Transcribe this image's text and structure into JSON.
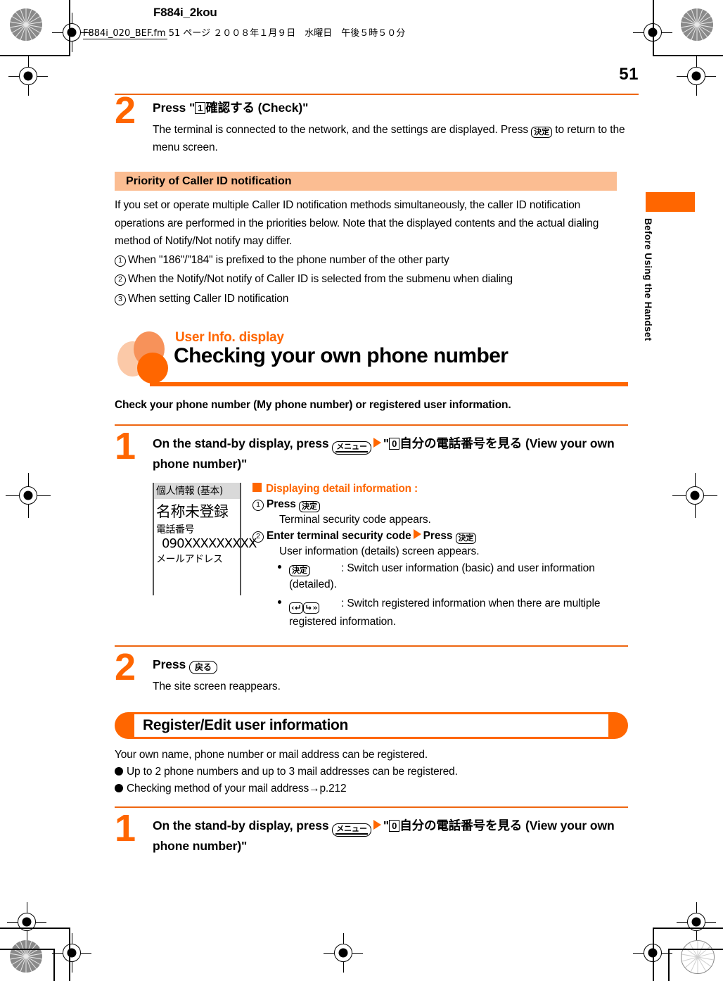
{
  "header": {
    "job_name": "F884i_2kou",
    "fm_line": "F884i_020_BEF.fm  51 ページ  ２００８年１月９日　水曜日　午後５時５０分",
    "page_number": "51"
  },
  "side_tab": {
    "label": "Before Using the Handset"
  },
  "step_top": {
    "number": "2",
    "title_pre": "Press \"",
    "title_key": "1",
    "title_jp": "確認する",
    "title_post": " (Check)\"",
    "body_pre": "The terminal is connected to the network, and the settings are displayed. Press ",
    "body_key": "決定",
    "body_post": " to return to the menu screen."
  },
  "priority_section": {
    "heading": "Priority of Caller ID notification",
    "paragraph": "If you set or operate multiple Caller ID notification methods simultaneously, the caller ID notification operations are performed in the priorities below. Note that the displayed contents and the actual dialing method of Notify/Not notify may differ.",
    "items": [
      {
        "marker": "1",
        "text": "When \"186\"/\"184\" is prefixed to the phone number of the other party"
      },
      {
        "marker": "2",
        "text": "When the Notify/Not notify of Caller ID is selected from the submenu when dialing"
      },
      {
        "marker": "3",
        "text": "When setting Caller ID notification"
      }
    ]
  },
  "main_section": {
    "eyebrow": "User Info. display",
    "title": "Checking your own phone number",
    "lead": "Check your phone number (My phone number) or registered user information."
  },
  "step_one": {
    "number": "1",
    "text_a": "On the stand-by display, press ",
    "key_menu": "メニュー",
    "text_b": "\"",
    "numkey": "0",
    "text_jp": "自分の電話番号を見る",
    "text_c": " (View your own phone number)\""
  },
  "phone_screen": {
    "title": "個人情報 (基本)",
    "name": "名称未登録",
    "label_phone": "電話番号",
    "number": "090XXXXXXXXX",
    "label_mail": "メールアドレス"
  },
  "detail_info": {
    "heading": "Displaying detail information :",
    "step1_marker": "1",
    "step1_label": "Press",
    "step1_key": "決定",
    "step1_result": "Terminal security code appears.",
    "step2_marker": "2",
    "step2_label": "Enter terminal security code",
    "step2_label2": "Press",
    "step2_key": "決定",
    "step2_result": "User information (details) screen appears.",
    "bullets": [
      {
        "key": "決定",
        "key_type": "single",
        "text": ": Switch user information (basic) and user information (detailed)."
      },
      {
        "key_left": "‹↵",
        "key_right": "↳»",
        "key_type": "pair",
        "text": ": Switch registered information when there are multiple registered information."
      }
    ]
  },
  "step_two": {
    "number": "2",
    "label": "Press",
    "key": "戻る",
    "body": "The site screen reappears."
  },
  "register_section": {
    "banner": "Register/Edit user information",
    "intro": "Your own name, phone number or mail address can be registered.",
    "bullets": [
      "Up to 2 phone numbers and up to 3 mail addresses can be registered.",
      "Checking method of your mail address→p.212"
    ]
  },
  "step_one_b": {
    "number": "1",
    "text_a": "On the stand-by display, press ",
    "key_menu": "メニュー",
    "text_b": "\"",
    "numkey": "0",
    "text_jp": "自分の電話番号を見る",
    "text_c": " (View your own phone number)\""
  },
  "colors": {
    "orange": "#ff6600",
    "orange_rule": "#ee6611",
    "peach_bar": "#fbbd92",
    "peach_light": "#fbc9a8",
    "peach_mid": "#f7925a",
    "screen_title_bg": "#d9d9d9"
  }
}
